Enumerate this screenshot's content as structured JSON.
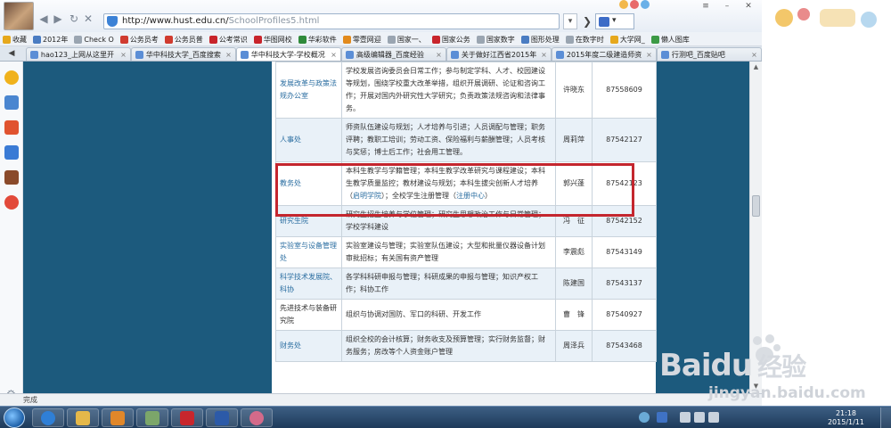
{
  "browser": {
    "address_url_host": "http://www.hust.edu.cn/",
    "address_url_path": "SchoolProfiles5.html",
    "status_text": "完成"
  },
  "favorites": [
    {
      "label": "收藏",
      "color": "#e6a81c"
    },
    {
      "label": "2012年",
      "color": "#4a7cc2"
    },
    {
      "label": "Check O",
      "color": "#9aa5b1"
    },
    {
      "label": "公务员考",
      "color": "#d03b2f"
    },
    {
      "label": "公务员普",
      "color": "#d03b2f"
    },
    {
      "label": "公考常识",
      "color": "#c8242b"
    },
    {
      "label": "华图网校",
      "color": "#c8242b"
    },
    {
      "label": "华彩软件",
      "color": "#2f8a3a"
    },
    {
      "label": "零壹网迎",
      "color": "#e28a1c"
    },
    {
      "label": "国家一、",
      "color": "#9aa5b1"
    },
    {
      "label": "国家公务",
      "color": "#c8242b"
    },
    {
      "label": "国家数字",
      "color": "#9aa5b1"
    },
    {
      "label": "图形处理",
      "color": "#4a7cc2"
    },
    {
      "label": "在数字时",
      "color": "#9aa5b1"
    },
    {
      "label": "大学网_",
      "color": "#e6a81c"
    },
    {
      "label": "懒人图库",
      "color": "#3c9a45"
    }
  ],
  "tabs": [
    {
      "label": "hao123_上网从这里开",
      "active": false
    },
    {
      "label": "华中科技大学_百度搜索",
      "active": false
    },
    {
      "label": "华中科技大学-学校概况",
      "active": true
    },
    {
      "label": "高级编辑器_百度经验",
      "active": false
    },
    {
      "label": "关于做好江西省2015年",
      "active": false
    },
    {
      "label": "2015年度二级建造师资",
      "active": false
    },
    {
      "label": "行测吧_百度贴吧",
      "active": false
    }
  ],
  "table": {
    "rows": [
      {
        "dept": "发展改革与政策法规办公室",
        "duty": "学校发展咨询委员会日常工作；参与制定学科、人才、校园建设等规划，围绕学校重大改革举措，组织开展调研、论证和咨询工作；开展对国内外研究性大学研究；负责政策法规咨询和法律事务。",
        "head": "许晓东",
        "phone": "87558609",
        "style": "plain"
      },
      {
        "dept": "人事处",
        "duty": "师资队伍建设与规划；人才培养与引进；人员调配与管理；职务评聘；教职工培训；劳动工资、保险福利与薪酬管理；人员考核与奖惩；博士后工作；社会用工管理。",
        "head": "周莉萍",
        "phone": "87542127",
        "style": "alt"
      },
      {
        "dept": "教务处",
        "duty_pre": "本科生教学与学籍管理；本科生教学改革研究与课程建设；本科生教学质量监控；教材建设与规划；本科生拔尖创新人才培养（",
        "duty_link1": "启明学院",
        "duty_mid": "）；全校学生注册管理（",
        "duty_link2": "注册中心",
        "duty_post": "）",
        "head": "郭兴蓬",
        "phone": "87542123",
        "style": "plain"
      },
      {
        "dept": "研究生院",
        "duty": "研究生招生培养与学位管理；研究生思想政治工作与日常管理；学校学科建设",
        "head": "冯　征",
        "phone": "87542152",
        "style": "alt"
      },
      {
        "dept": "实验室与设备管理处",
        "duty": "实验室建设与管理；实验室队伍建设；大型和批量仪器设备计划审批招标；有关国有资产管理",
        "head": "李震彪",
        "phone": "87543149",
        "style": "plain"
      },
      {
        "dept": "科学技术发展院、科协",
        "duty": "各学科科研申报与管理；科研成果的申报与管理；知识产权工作；科协工作",
        "head": "陈建国",
        "phone": "87543137",
        "style": "alt"
      },
      {
        "dept": "先进技术与装备研究院",
        "duty": "组织与协调对国防、军口的科研、开发工作",
        "head": "曹　锋",
        "phone": "87540927",
        "style": "plain",
        "dept_plain": true
      },
      {
        "dept": "财务处",
        "duty": "组织全校的会计核算；财务收支及预算管理；实行财务监督；财务服务；房改等个人资金账户管理",
        "head": "周泽兵",
        "phone": "87543468",
        "style": "alt"
      }
    ]
  },
  "watermark": {
    "brand": "Bai",
    "brand2": "du",
    "brand_cn": "经验",
    "site": "jingyan.baidu.com"
  },
  "taskbar": {
    "time": "21:18",
    "date": "2015/1/11"
  },
  "colors": {
    "band": "#1c5a7d",
    "highlight": "#c4262e",
    "link": "#2b6ea1"
  }
}
